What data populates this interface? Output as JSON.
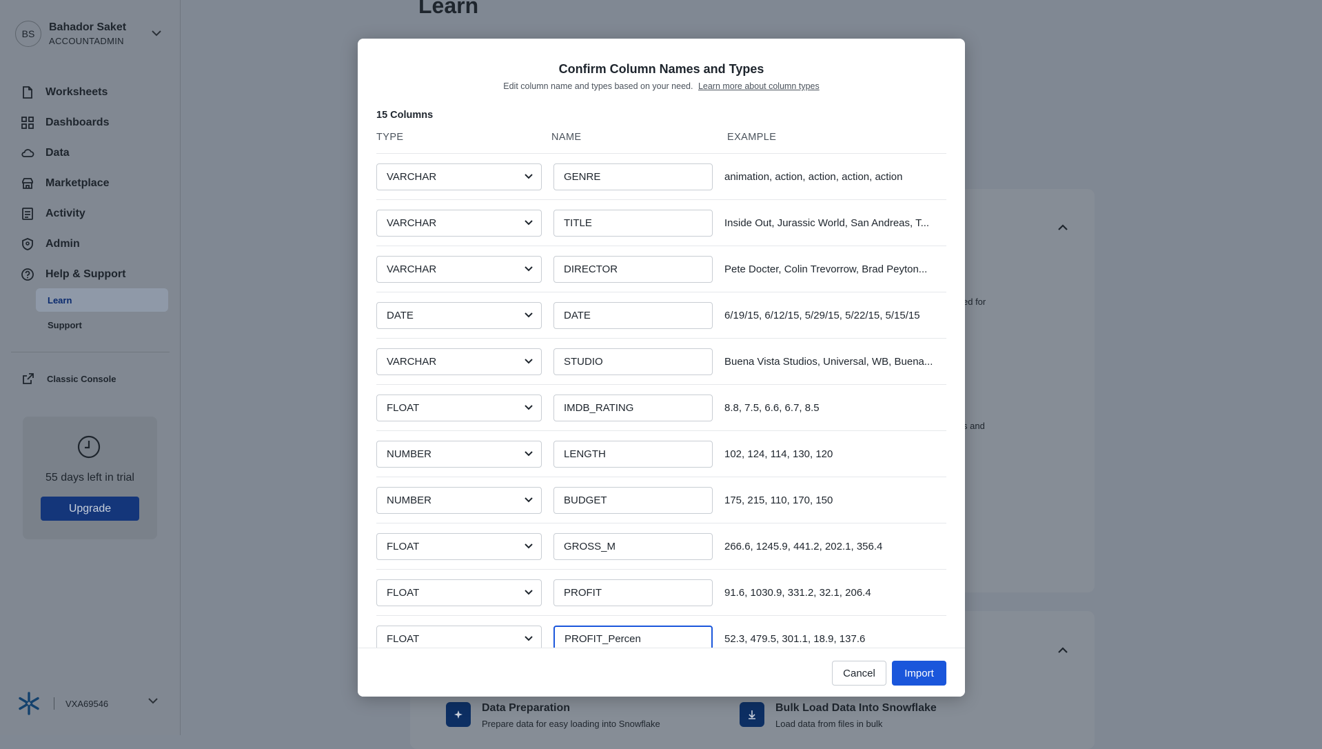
{
  "sidebar": {
    "user": {
      "initials": "BS",
      "name": "Bahador Saket",
      "role": "ACCOUNTADMIN"
    },
    "nav": [
      {
        "label": "Worksheets",
        "icon": "document-icon"
      },
      {
        "label": "Dashboards",
        "icon": "grid-icon"
      },
      {
        "label": "Data",
        "icon": "cloud-icon"
      },
      {
        "label": "Marketplace",
        "icon": "store-icon"
      },
      {
        "label": "Activity",
        "icon": "activity-icon"
      },
      {
        "label": "Admin",
        "icon": "shield-icon"
      },
      {
        "label": "Help & Support",
        "icon": "help-icon"
      }
    ],
    "subnav": [
      {
        "label": "Learn",
        "active": true
      },
      {
        "label": "Support",
        "active": false
      }
    ],
    "classic_console": "Classic Console",
    "trial": {
      "text": "55 days left in trial",
      "button": "Upgrade"
    },
    "account": "VXA69546"
  },
  "background": {
    "page_title": "Learn",
    "fragment_1": "ed for",
    "fragment_2": "s and",
    "items": [
      {
        "title": "Data Preparation",
        "desc": "Prepare data for easy loading into Snowflake",
        "icon": "sparkle-icon"
      },
      {
        "title": "Bulk Load Data Into Snowflake",
        "desc": "Load data from files in bulk",
        "icon": "download-icon"
      }
    ]
  },
  "modal": {
    "title": "Confirm Column Names and Types",
    "subtitle": "Edit column name and types based on your need.",
    "learn_more": "Learn more about column types",
    "count": "15 Columns",
    "headers": {
      "type": "TYPE",
      "name": "NAME",
      "example": "EXAMPLE"
    },
    "rows": [
      {
        "type": "VARCHAR",
        "name": "GENRE",
        "example": "animation, action, action, action, action"
      },
      {
        "type": "VARCHAR",
        "name": "TITLE",
        "example": "Inside Out, Jurassic World, San Andreas, T..."
      },
      {
        "type": "VARCHAR",
        "name": "DIRECTOR",
        "example": "Pete Docter, Colin Trevorrow, Brad Peyton..."
      },
      {
        "type": "DATE",
        "name": "DATE",
        "example": "6/19/15, 6/12/15, 5/29/15, 5/22/15, 5/15/15"
      },
      {
        "type": "VARCHAR",
        "name": "STUDIO",
        "example": "Buena Vista Studios, Universal, WB, Buena..."
      },
      {
        "type": "FLOAT",
        "name": "IMDB_RATING",
        "example": "8.8, 7.5, 6.6, 6.7, 8.5"
      },
      {
        "type": "NUMBER",
        "name": "LENGTH",
        "example": "102, 124, 114, 130, 120"
      },
      {
        "type": "NUMBER",
        "name": "BUDGET",
        "example": "175, 215, 110, 170, 150"
      },
      {
        "type": "FLOAT",
        "name": "GROSS_M",
        "example": "266.6, 1245.9, 441.2, 202.1, 356.4"
      },
      {
        "type": "FLOAT",
        "name": "PROFIT",
        "example": "91.6, 1030.9, 331.2, 32.1, 206.4"
      },
      {
        "type": "FLOAT",
        "name": "PROFIT_Percen",
        "example": "52.3, 479.5, 301.1, 18.9, 137.6"
      }
    ],
    "cancel": "Cancel",
    "import": "Import"
  }
}
